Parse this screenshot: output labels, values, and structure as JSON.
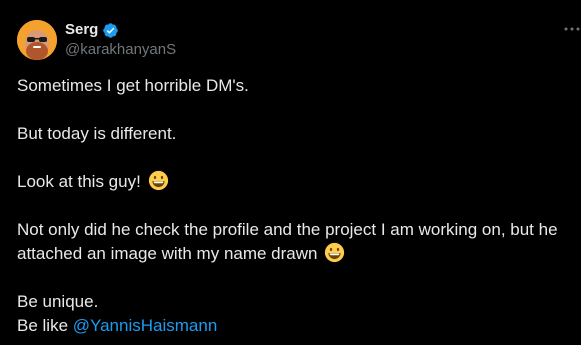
{
  "tweet": {
    "author": {
      "display_name": "Serg",
      "handle": "@karakhanyanS",
      "verified": true,
      "avatar_icon": "avatar-photo",
      "avatar_color": "#f4a12e"
    },
    "more_icon": "more-options-icon",
    "lines": {
      "line1": "Sometimes I get horrible DM's.",
      "line2": "But today is different.",
      "line3": "Look at this guy!",
      "line4a": "Not only did he check the profile and the project I am working on, but he",
      "line4b": "attached an image with my name drawn",
      "line5": "Be unique.",
      "line6_prefix": "Be like",
      "mention": "@YannisHaismann"
    },
    "emoji_icon": "grinning-face-emoji",
    "colors": {
      "background": "#000000",
      "text": "#e7e9ea",
      "secondary": "#71767b",
      "link": "#1d9bf0",
      "verified": "#1d9bf0"
    }
  }
}
